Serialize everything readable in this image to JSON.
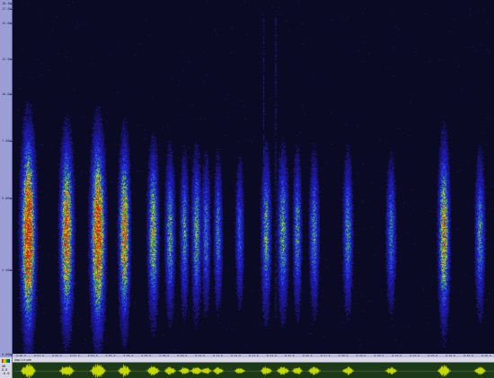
{
  "app": {
    "colors": {
      "background": "#0a0a22",
      "axis": "#9a9ed4",
      "timebar": "#b9bcd8",
      "wave_bg": "#1c3a18",
      "wave_line": "#c8d800"
    }
  },
  "freq_axis": {
    "ticks": [
      {
        "label": "18.3kHz",
        "frac": 0.005
      },
      {
        "label": "17.5kHz",
        "frac": 0.02
      },
      {
        "label": "15.0kHz",
        "frac": 0.06
      },
      {
        "label": "12.5kHz",
        "frac": 0.16
      },
      {
        "label": "10.0kHz",
        "frac": 0.26
      },
      {
        "label": "7.50kHz",
        "frac": 0.39
      },
      {
        "label": "5.00kHz",
        "frac": 0.55
      },
      {
        "label": "2.50kHz",
        "frac": 0.75
      },
      {
        "label": "0.00kHz",
        "frac": 0.998
      }
    ]
  },
  "time_axis": {
    "labels": [
      "0:00.0",
      "0:01.0",
      "0:02.0",
      "0:03.0",
      "0:04.0",
      "0:05.0",
      "0:06.0",
      "0:07.0",
      "0:08.0",
      "0:09.0",
      "0:10.0",
      "0:11.0",
      "0:12.0",
      "0:13.0",
      "0:14.0",
      "0:15.0",
      "0:16.0",
      "0:17.0",
      "0:18.0",
      "0:19.0",
      "0:20.0",
      "0:21.0",
      "0:22.0",
      "0:23.0",
      "0:24.0",
      "0:25.0",
      "0:26.0"
    ]
  },
  "waveform": {
    "title": "Amplitude",
    "side_labels": [
      "dB",
      "0.0",
      "-6.0"
    ]
  },
  "spectrogram": {
    "calls": [
      {
        "x": 0.03,
        "w": 0.018,
        "level": 1.0
      },
      {
        "x": 0.11,
        "w": 0.016,
        "level": 0.85
      },
      {
        "x": 0.175,
        "w": 0.018,
        "level": 0.95
      },
      {
        "x": 0.23,
        "w": 0.012,
        "level": 0.8
      },
      {
        "x": 0.29,
        "w": 0.012,
        "level": 0.65
      },
      {
        "x": 0.325,
        "w": 0.01,
        "level": 0.55
      },
      {
        "x": 0.355,
        "w": 0.008,
        "level": 0.5
      },
      {
        "x": 0.38,
        "w": 0.01,
        "level": 0.55
      },
      {
        "x": 0.4,
        "w": 0.008,
        "level": 0.45
      },
      {
        "x": 0.425,
        "w": 0.008,
        "level": 0.45
      },
      {
        "x": 0.47,
        "w": 0.008,
        "level": 0.4
      },
      {
        "x": 0.525,
        "w": 0.01,
        "level": 0.55
      },
      {
        "x": 0.56,
        "w": 0.012,
        "level": 0.55
      },
      {
        "x": 0.59,
        "w": 0.008,
        "level": 0.5
      },
      {
        "x": 0.625,
        "w": 0.01,
        "level": 0.5
      },
      {
        "x": 0.695,
        "w": 0.01,
        "level": 0.5
      },
      {
        "x": 0.785,
        "w": 0.01,
        "level": 0.45
      },
      {
        "x": 0.895,
        "w": 0.012,
        "level": 0.75
      },
      {
        "x": 0.97,
        "w": 0.01,
        "level": 0.5
      }
    ]
  }
}
